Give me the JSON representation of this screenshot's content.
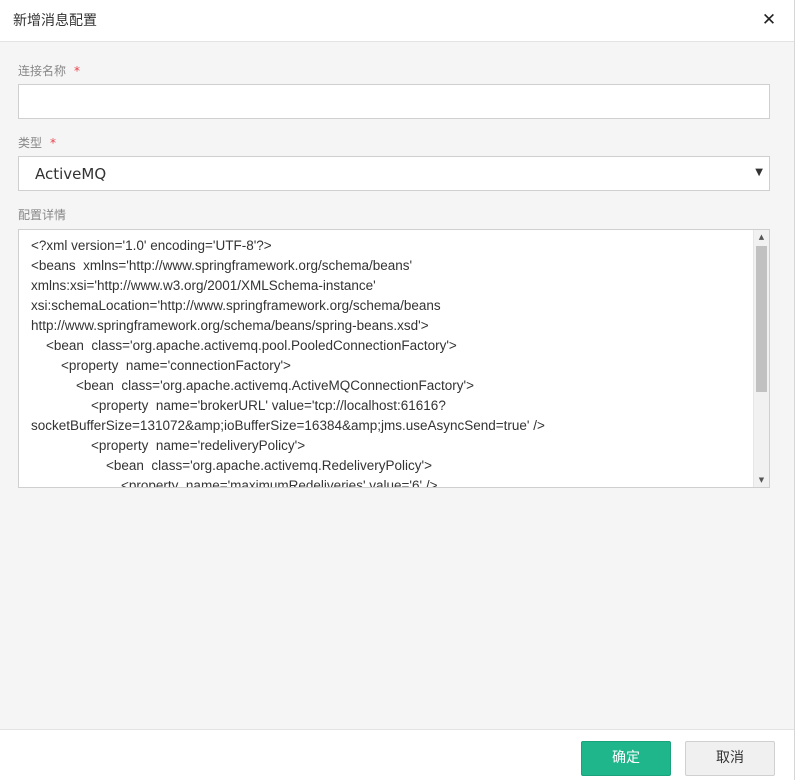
{
  "dialog": {
    "title": "新增消息配置",
    "close_glyph": "✕"
  },
  "form": {
    "connection_name": {
      "label": "连接名称",
      "required_mark": "*",
      "value": "",
      "placeholder": ""
    },
    "type": {
      "label": "类型",
      "required_mark": "*",
      "selected": "ActiveMQ",
      "arrow_glyph": "▼"
    },
    "config_detail": {
      "label": "配置详情",
      "lines": [
        "<?xml version='1.0' encoding='UTF-8'?>",
        "<beans  xmlns='http://www.springframework.org/schema/beans'",
        "xmlns:xsi='http://www.w3.org/2001/XMLSchema-instance'",
        "xsi:schemaLocation='http://www.springframework.org/schema/beans",
        "http://www.springframework.org/schema/beans/spring-beans.xsd'>",
        "    <bean  class='org.apache.activemq.pool.PooledConnectionFactory'>",
        "        <property  name='connectionFactory'>",
        "            <bean  class='org.apache.activemq.ActiveMQConnectionFactory'>",
        "                <property  name='brokerURL' value='tcp://localhost:61616?",
        "socketBufferSize=131072&amp;ioBufferSize=16384&amp;jms.useAsyncSend=true' />",
        "                <property  name='redeliveryPolicy'>",
        "                    <bean  class='org.apache.activemq.RedeliveryPolicy'>",
        "                        <property  name='maximumRedeliveries' value='6' />"
      ]
    }
  },
  "footer": {
    "confirm_label": "确定",
    "cancel_label": "取消"
  },
  "colors": {
    "confirm_bg": "#1fb68c",
    "required": "#e8424c"
  }
}
